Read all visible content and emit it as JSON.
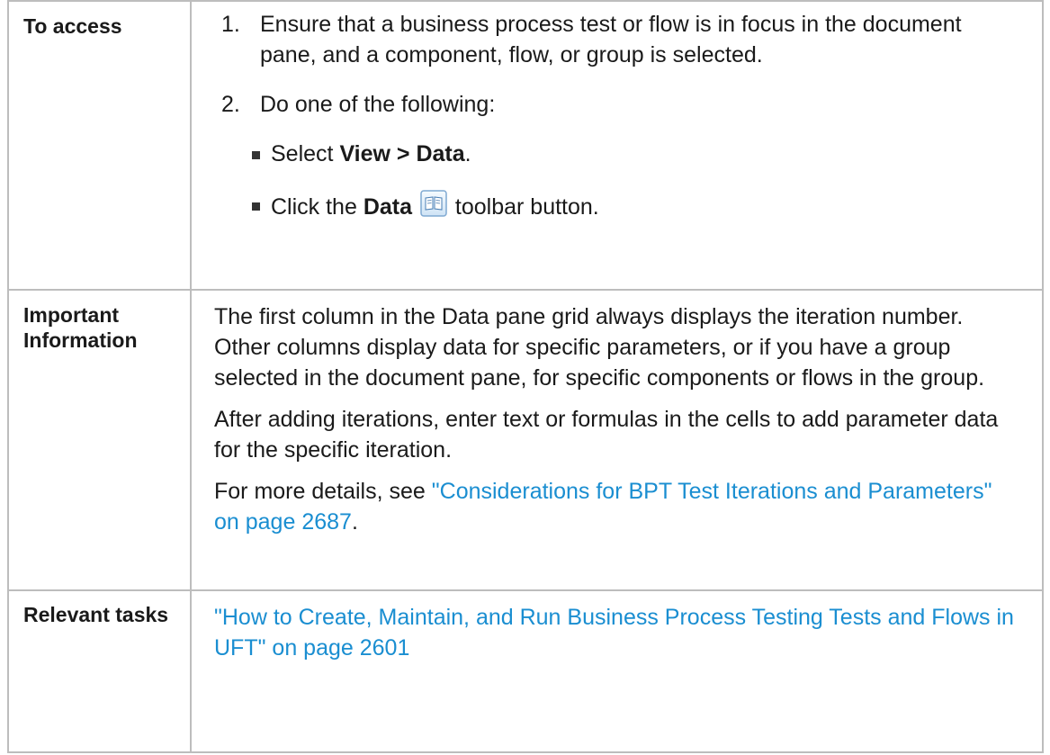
{
  "rows": [
    {
      "heading": "To access",
      "step1_num": "1.",
      "step1_text": "Ensure that a business process test or flow is in focus in the document pane, and a component, flow, or group is selected.",
      "step2_num": "2.",
      "step2_text": "Do one of the following:",
      "bullet1_prefix": "Select ",
      "bullet1_bold": "View > Data",
      "bullet1_suffix": ".",
      "bullet2_prefix": "Click the ",
      "bullet2_bold": "Data",
      "bullet2_icon": "data-book-icon",
      "bullet2_suffix": " toolbar button."
    },
    {
      "heading": "Important Information",
      "para1": "The first column in the Data pane grid always displays the iteration number. Other columns display data for specific parameters, or if you have a group selected in the document pane, for specific components or flows in the group.",
      "para2": "After adding iterations, enter text or formulas in the cells to add parameter data for the specific iteration.",
      "para3_prefix": "For more details, see ",
      "para3_link": "\"Considerations for BPT Test Iterations and Parameters\" on page 2687",
      "para3_suffix": "."
    },
    {
      "heading": "Relevant tasks",
      "link": "\"How to Create, Maintain, and Run Business Process Testing Tests and Flows in UFT\" on page 2601"
    }
  ],
  "colors": {
    "link": "#1a8ed1",
    "border": "#bdbdbd"
  }
}
